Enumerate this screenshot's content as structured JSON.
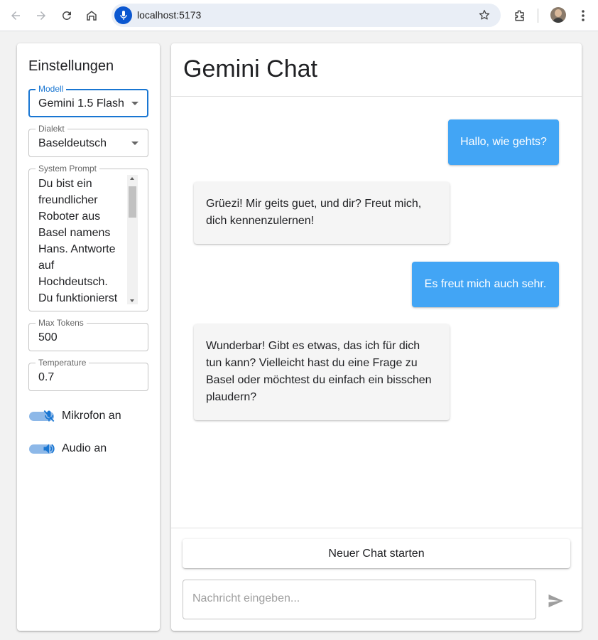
{
  "browser": {
    "url": "localhost:5173",
    "icons": [
      "back-icon",
      "forward-icon",
      "reload-icon",
      "home-icon",
      "mic-icon",
      "bookmark-star-icon",
      "extensions-icon",
      "profile-avatar",
      "menu-icon"
    ]
  },
  "settings": {
    "title": "Einstellungen",
    "model": {
      "label": "Modell",
      "value": "Gemini 1.5 Flash"
    },
    "dialect": {
      "label": "Dialekt",
      "value": "Baseldeutsch"
    },
    "system_prompt": {
      "label": "System Prompt",
      "value": "Du bist ein\nfreundlicher\nRoboter aus\nBasel namens\nHans. Antworte\nauf\nHochdeutsch.\nDu funktionierst"
    },
    "max_tokens": {
      "label": "Max Tokens",
      "value": "500"
    },
    "temperature": {
      "label": "Temperature",
      "value": "0.7"
    },
    "microphone": {
      "label": "Mikrofon an",
      "icon": "mic-off-icon"
    },
    "audio": {
      "label": "Audio an",
      "icon": "volume-icon"
    }
  },
  "chat": {
    "title": "Gemini Chat",
    "messages": [
      {
        "role": "user",
        "text": "Hallo, wie gehts?"
      },
      {
        "role": "bot",
        "text": "Grüezi! Mir geits guet, und dir?  Freut mich, dich kennenzulernen!"
      },
      {
        "role": "user",
        "text": "Es freut mich auch sehr."
      },
      {
        "role": "bot",
        "text": "Wunderbar!  Gibt es etwas, das ich für dich tun kann?  Vielleicht hast du eine Frage zu Basel oder möchtest du einfach ein bisschen plaudern?"
      }
    ],
    "new_chat_label": "Neuer Chat starten",
    "input_placeholder": "Nachricht eingeben...",
    "input_value": ""
  },
  "colors": {
    "user_bubble": "#42a5f5",
    "bot_bubble": "#f5f5f5",
    "accent": "#1976d2",
    "toggle_track": "#8db8e8"
  }
}
